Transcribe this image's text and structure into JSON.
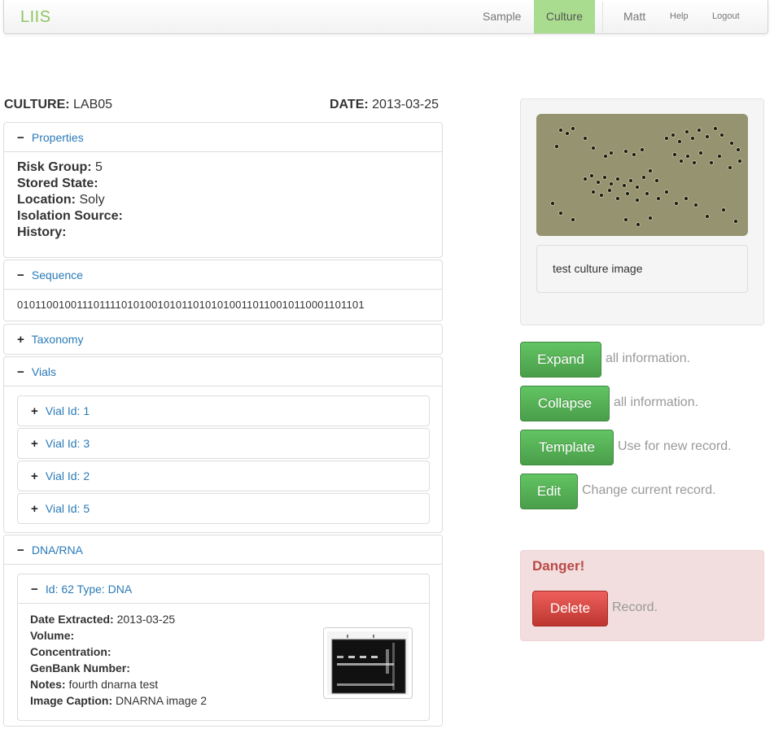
{
  "navbar": {
    "brand": "LIIS",
    "items": [
      {
        "label": "Sample"
      },
      {
        "label": "Culture"
      },
      {
        "label": "Matt"
      },
      {
        "label": "Help"
      },
      {
        "label": "Logout"
      }
    ]
  },
  "record": {
    "culture_label": "CULTURE:",
    "culture_value": "LAB05",
    "date_label": "DATE:",
    "date_value": "2013-03-25"
  },
  "properties": {
    "title": "Properties",
    "fields": [
      {
        "label": "Risk Group:",
        "value": "5"
      },
      {
        "label": "Stored State:",
        "value": ""
      },
      {
        "label": "Location:",
        "value": "Soly"
      },
      {
        "label": "Isolation Source:",
        "value": ""
      },
      {
        "label": "History:",
        "value": ""
      }
    ]
  },
  "sequence": {
    "title": "Sequence",
    "value": "0101100100111011110101001010110101010011011001011000110​1101"
  },
  "taxonomy": {
    "title": "Taxonomy"
  },
  "vials": {
    "title": "Vials",
    "items": [
      {
        "label": "Vial Id: 1"
      },
      {
        "label": "Vial Id: 3"
      },
      {
        "label": "Vial Id: 2"
      },
      {
        "label": "Vial Id: 5"
      }
    ]
  },
  "dnarna": {
    "title": "DNA/RNA",
    "entry": {
      "title": "Id: 62 Type: DNA",
      "fields": [
        {
          "label": "Date Extracted:",
          "value": "2013-03-25"
        },
        {
          "label": "Volume:",
          "value": ""
        },
        {
          "label": "Concentration:",
          "value": ""
        },
        {
          "label": "GenBank Number:",
          "value": ""
        },
        {
          "label": "Notes:",
          "value": "fourth dnarna test"
        },
        {
          "label": "Image Caption:",
          "value": "DNARNA image 2"
        }
      ]
    }
  },
  "image_panel": {
    "caption": "test culture image"
  },
  "actions": [
    {
      "label": "Expand",
      "note": "all information."
    },
    {
      "label": "Collapse",
      "note": "all information."
    },
    {
      "label": "Template",
      "note": "Use for new record."
    },
    {
      "label": "Edit",
      "note": "Change current record."
    }
  ],
  "danger": {
    "title": "Danger!",
    "button": "Delete",
    "note": "Record."
  },
  "icons": {
    "expanded": "minus-icon",
    "collapsed": "plus-icon"
  },
  "colors": {
    "brand": "#8cc660",
    "active_tab": "#a9dc8f",
    "link": "#2a7ab8",
    "success": "#5bb75b",
    "danger": "#da4f49"
  }
}
